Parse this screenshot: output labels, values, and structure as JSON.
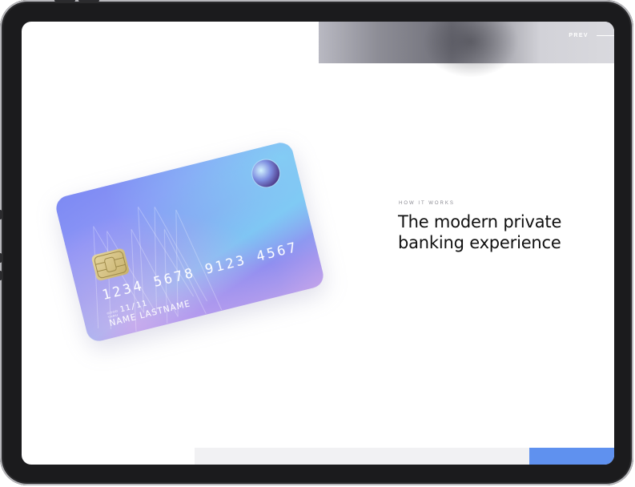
{
  "nav": {
    "prev_label": "PREV"
  },
  "section": {
    "eyebrow": "HOW IT WORKS",
    "headline": "The modern private banking experience"
  },
  "card": {
    "number": "1234 5678 9123 4567",
    "thru_label_line1": "GOOD",
    "thru_label_line2": "THRU",
    "expiry": "11/11",
    "holder_name": "NAME LASTNAME"
  },
  "colors": {
    "accent": "#5f91ef",
    "text_dark": "#111111",
    "text_muted": "#8a8a92",
    "device_frame": "#1b1b1d"
  },
  "icons": [
    "card-chip-icon",
    "hologram-icon"
  ]
}
